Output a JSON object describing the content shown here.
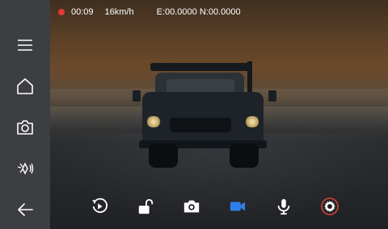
{
  "status": {
    "recording_color": "#e53935",
    "elapsed": "00:09",
    "speed": "16km/h",
    "coordinates": "E:00.0000 N:00.0000"
  },
  "sidebar": {
    "items": [
      {
        "icon": "menu-icon"
      },
      {
        "icon": "home-icon"
      },
      {
        "icon": "camera-icon"
      },
      {
        "icon": "parking-sensor-icon"
      },
      {
        "icon": "back-arrow-icon"
      }
    ]
  },
  "toolbar": {
    "items": [
      {
        "icon": "replay-icon"
      },
      {
        "icon": "unlock-icon"
      },
      {
        "icon": "snapshot-icon"
      },
      {
        "icon": "video-camera-icon",
        "active_color": "#2f7ee8"
      },
      {
        "icon": "microphone-icon"
      },
      {
        "icon": "settings-icon",
        "highlight_color": "#e1433b"
      }
    ]
  }
}
